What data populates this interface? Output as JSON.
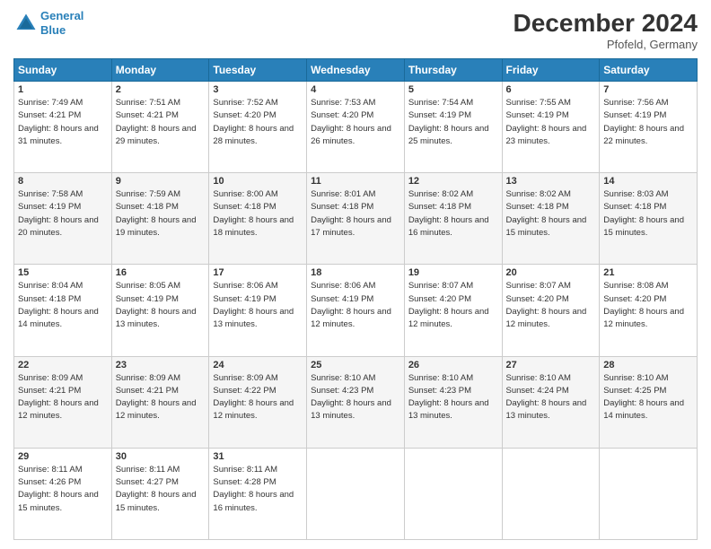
{
  "header": {
    "logo_line1": "General",
    "logo_line2": "Blue",
    "month_title": "December 2024",
    "location": "Pfofeld, Germany"
  },
  "weekdays": [
    "Sunday",
    "Monday",
    "Tuesday",
    "Wednesday",
    "Thursday",
    "Friday",
    "Saturday"
  ],
  "weeks": [
    [
      {
        "day": "1",
        "sunrise": "7:49 AM",
        "sunset": "4:21 PM",
        "daylight": "8 hours and 31 minutes."
      },
      {
        "day": "2",
        "sunrise": "7:51 AM",
        "sunset": "4:21 PM",
        "daylight": "8 hours and 29 minutes."
      },
      {
        "day": "3",
        "sunrise": "7:52 AM",
        "sunset": "4:20 PM",
        "daylight": "8 hours and 28 minutes."
      },
      {
        "day": "4",
        "sunrise": "7:53 AM",
        "sunset": "4:20 PM",
        "daylight": "8 hours and 26 minutes."
      },
      {
        "day": "5",
        "sunrise": "7:54 AM",
        "sunset": "4:19 PM",
        "daylight": "8 hours and 25 minutes."
      },
      {
        "day": "6",
        "sunrise": "7:55 AM",
        "sunset": "4:19 PM",
        "daylight": "8 hours and 23 minutes."
      },
      {
        "day": "7",
        "sunrise": "7:56 AM",
        "sunset": "4:19 PM",
        "daylight": "8 hours and 22 minutes."
      }
    ],
    [
      {
        "day": "8",
        "sunrise": "7:58 AM",
        "sunset": "4:19 PM",
        "daylight": "8 hours and 20 minutes."
      },
      {
        "day": "9",
        "sunrise": "7:59 AM",
        "sunset": "4:18 PM",
        "daylight": "8 hours and 19 minutes."
      },
      {
        "day": "10",
        "sunrise": "8:00 AM",
        "sunset": "4:18 PM",
        "daylight": "8 hours and 18 minutes."
      },
      {
        "day": "11",
        "sunrise": "8:01 AM",
        "sunset": "4:18 PM",
        "daylight": "8 hours and 17 minutes."
      },
      {
        "day": "12",
        "sunrise": "8:02 AM",
        "sunset": "4:18 PM",
        "daylight": "8 hours and 16 minutes."
      },
      {
        "day": "13",
        "sunrise": "8:02 AM",
        "sunset": "4:18 PM",
        "daylight": "8 hours and 15 minutes."
      },
      {
        "day": "14",
        "sunrise": "8:03 AM",
        "sunset": "4:18 PM",
        "daylight": "8 hours and 15 minutes."
      }
    ],
    [
      {
        "day": "15",
        "sunrise": "8:04 AM",
        "sunset": "4:18 PM",
        "daylight": "8 hours and 14 minutes."
      },
      {
        "day": "16",
        "sunrise": "8:05 AM",
        "sunset": "4:19 PM",
        "daylight": "8 hours and 13 minutes."
      },
      {
        "day": "17",
        "sunrise": "8:06 AM",
        "sunset": "4:19 PM",
        "daylight": "8 hours and 13 minutes."
      },
      {
        "day": "18",
        "sunrise": "8:06 AM",
        "sunset": "4:19 PM",
        "daylight": "8 hours and 12 minutes."
      },
      {
        "day": "19",
        "sunrise": "8:07 AM",
        "sunset": "4:20 PM",
        "daylight": "8 hours and 12 minutes."
      },
      {
        "day": "20",
        "sunrise": "8:07 AM",
        "sunset": "4:20 PM",
        "daylight": "8 hours and 12 minutes."
      },
      {
        "day": "21",
        "sunrise": "8:08 AM",
        "sunset": "4:20 PM",
        "daylight": "8 hours and 12 minutes."
      }
    ],
    [
      {
        "day": "22",
        "sunrise": "8:09 AM",
        "sunset": "4:21 PM",
        "daylight": "8 hours and 12 minutes."
      },
      {
        "day": "23",
        "sunrise": "8:09 AM",
        "sunset": "4:21 PM",
        "daylight": "8 hours and 12 minutes."
      },
      {
        "day": "24",
        "sunrise": "8:09 AM",
        "sunset": "4:22 PM",
        "daylight": "8 hours and 12 minutes."
      },
      {
        "day": "25",
        "sunrise": "8:10 AM",
        "sunset": "4:23 PM",
        "daylight": "8 hours and 13 minutes."
      },
      {
        "day": "26",
        "sunrise": "8:10 AM",
        "sunset": "4:23 PM",
        "daylight": "8 hours and 13 minutes."
      },
      {
        "day": "27",
        "sunrise": "8:10 AM",
        "sunset": "4:24 PM",
        "daylight": "8 hours and 13 minutes."
      },
      {
        "day": "28",
        "sunrise": "8:10 AM",
        "sunset": "4:25 PM",
        "daylight": "8 hours and 14 minutes."
      }
    ],
    [
      {
        "day": "29",
        "sunrise": "8:11 AM",
        "sunset": "4:26 PM",
        "daylight": "8 hours and 15 minutes."
      },
      {
        "day": "30",
        "sunrise": "8:11 AM",
        "sunset": "4:27 PM",
        "daylight": "8 hours and 15 minutes."
      },
      {
        "day": "31",
        "sunrise": "8:11 AM",
        "sunset": "4:28 PM",
        "daylight": "8 hours and 16 minutes."
      },
      null,
      null,
      null,
      null
    ]
  ]
}
